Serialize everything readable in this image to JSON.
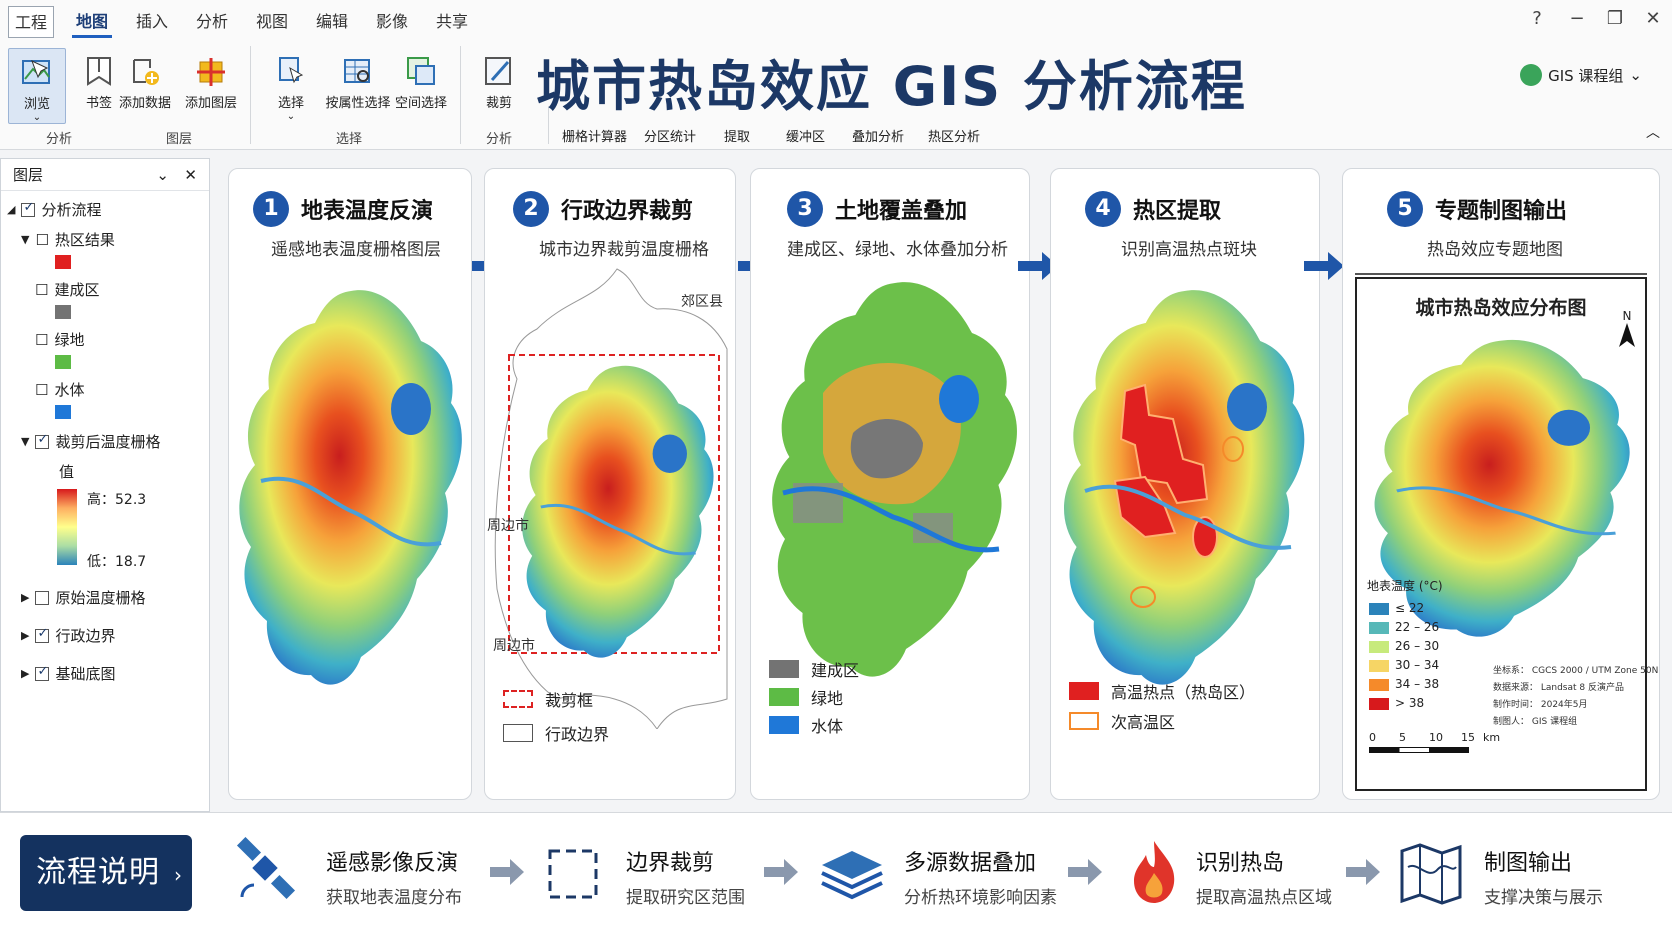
{
  "menu": {
    "tabs": [
      "工程",
      "地图",
      "插入",
      "分析",
      "视图",
      "编辑",
      "影像",
      "共享"
    ],
    "help": "?"
  },
  "ribbon": {
    "buttons": [
      "浏览",
      "书签",
      "添加数据",
      "添加图层",
      "选择",
      "按属性选择",
      "空间选择",
      "裁剪"
    ],
    "groups": [
      "分析",
      "图层",
      "选择",
      "分析"
    ],
    "subtools": [
      "栅格计算器",
      "分区统计",
      "提取",
      "缓冲区",
      "叠加分析",
      "热区分析"
    ]
  },
  "title": "城市热岛效应 GIS 分析流程",
  "user": "GIS 课程组",
  "layers": {
    "header": "图层",
    "root": "分析流程",
    "items": [
      "热区结果",
      "建成区",
      "绿地",
      "水体"
    ],
    "clipped": "裁剪后温度栅格",
    "value_label": "值",
    "high": "高：52.3",
    "low": "低：18.7",
    "others": [
      "原始温度栅格",
      "行政边界",
      "基础底图"
    ]
  },
  "steps": [
    {
      "num": "1",
      "title": "地表温度反演",
      "sub": "遥感地表温度栅格图层"
    },
    {
      "num": "2",
      "title": "行政边界裁剪",
      "sub": "城市边界裁剪温度栅格"
    },
    {
      "num": "3",
      "title": "土地覆盖叠加",
      "sub": "建成区、绿地、水体叠加分析"
    },
    {
      "num": "4",
      "title": "热区提取",
      "sub": "识别高温热点斑块"
    },
    {
      "num": "5",
      "title": "专题制图输出",
      "sub": "热岛效应专题地图"
    }
  ],
  "panel2": {
    "county": "郊区县",
    "city1": "周边市",
    "city2": "周边市",
    "legend": [
      "裁剪框",
      "行政边界"
    ]
  },
  "panel3": {
    "legend": [
      "建成区",
      "绿地",
      "水体"
    ]
  },
  "panel4": {
    "legend": [
      "高温热点（热岛区）",
      "次高温区"
    ]
  },
  "map": {
    "title": "城市热岛效应分布图",
    "north": "N",
    "legend_title": "地表温度 (°C)",
    "classes": [
      "≤ 22",
      "22 – 26",
      "26 – 30",
      "30 – 34",
      "34 – 38",
      "> 38"
    ],
    "meta": [
      "坐标系： CGCS 2000 / UTM Zone 50N",
      "数据来源： Landsat 8 反演产品",
      "制作时间： 2024年5月",
      "制图人： GIS 课程组"
    ],
    "scale": [
      "0",
      "5",
      "10",
      "15",
      "km"
    ]
  },
  "bottom": {
    "button": "流程说明",
    "steps": [
      {
        "t1": "遥感影像反演",
        "t2": "获取地表温度分布"
      },
      {
        "t1": "边界裁剪",
        "t2": "提取研究区范围"
      },
      {
        "t1": "多源数据叠加",
        "t2": "分析热环境影响因素"
      },
      {
        "t1": "识别热岛",
        "t2": "提取高温热点区域"
      },
      {
        "t1": "制图输出",
        "t2": "支撑决策与展示"
      }
    ]
  },
  "colors": {
    "accent": "#1f56a8",
    "dark": "#14325f",
    "red": "#e02020",
    "built": "#737373",
    "green": "#5dbb45",
    "water": "#1f78d8"
  }
}
